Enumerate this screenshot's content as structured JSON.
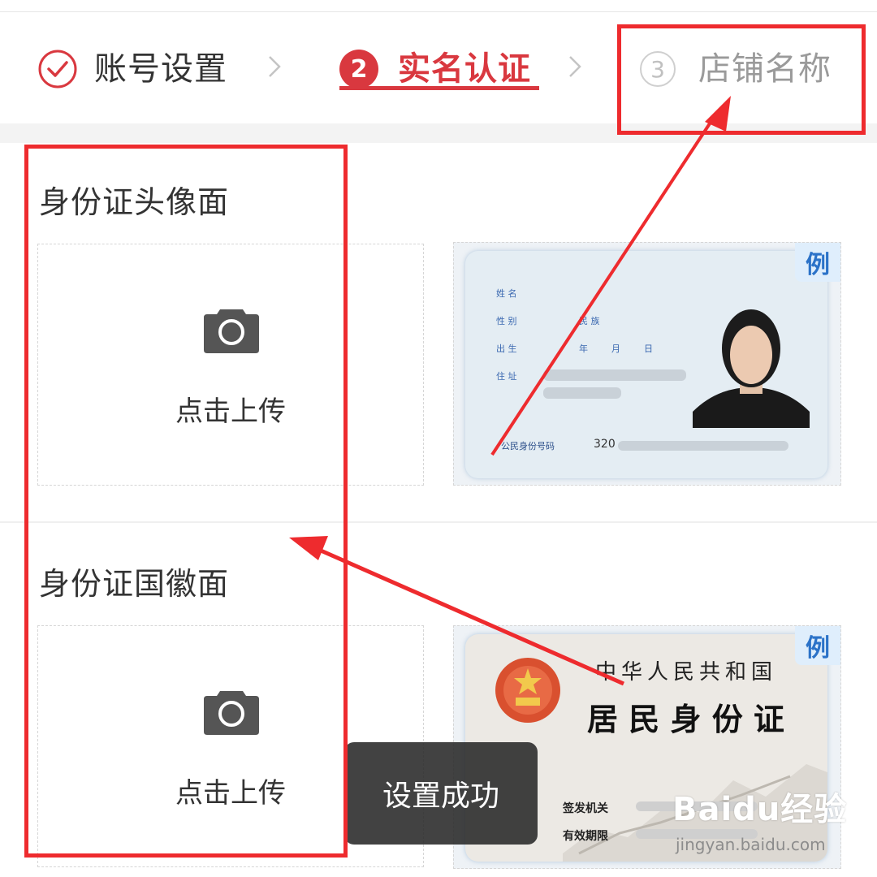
{
  "steps": [
    {
      "label": "账号设置",
      "state": "done"
    },
    {
      "number": "2",
      "label": "实名认证",
      "state": "active"
    },
    {
      "number": "3",
      "label": "店铺名称",
      "state": "pending"
    }
  ],
  "sections": {
    "front": {
      "title": "身份证头像面",
      "upload_label": "点击上传",
      "sample_badge": "例",
      "card": {
        "name_label": "姓 名",
        "gender_label": "性 别",
        "ethnic_label": "民 族",
        "birth_label": "出 生",
        "year": "年",
        "month": "月",
        "day": "日",
        "address_label": "住 址",
        "id_label": "公民身份号码",
        "id_prefix": "320"
      }
    },
    "back": {
      "title": "身份证国徽面",
      "upload_label": "点击上传",
      "sample_badge": "例",
      "card": {
        "country": "中华人民共和国",
        "doc_title": "居 民 身 份 证",
        "authority_label": "签发机关",
        "validity_label": "有效期限"
      }
    }
  },
  "toast": "设置成功",
  "watermark": {
    "brand": "Baidu经验",
    "url": "jingyan.baidu.com"
  },
  "colors": {
    "accent": "#d9383f",
    "annotation": "#ee2b2e",
    "badge_text": "#2b72c8"
  }
}
